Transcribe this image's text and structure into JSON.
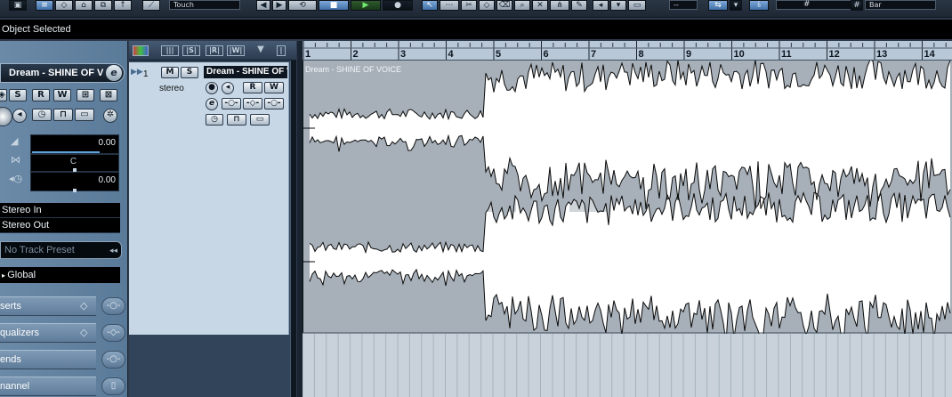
{
  "toolbar": {
    "automation_mode": "Touch",
    "snap_value": "--",
    "quantize": "Bar",
    "grid_icon": "grid-icon"
  },
  "infoline": {
    "text": "Object Selected"
  },
  "inspector": {
    "track_name": "Dream - SHINE OF V",
    "edit_symbol": "e",
    "mute": "M",
    "solo": "S",
    "read": "R",
    "write": "W",
    "volume": "0.00",
    "pan": "C",
    "delay": "0.00",
    "input": "Stereo In",
    "output": "Stereo Out",
    "preset": "No Track Preset",
    "group": "Global",
    "sections": [
      {
        "label": "serts"
      },
      {
        "label": "qualizers"
      },
      {
        "label": "ends"
      },
      {
        "label": "nannel"
      }
    ]
  },
  "tracklist": {
    "number": "1",
    "name": "Dream - SHINE OF VOICE",
    "type": "stereo",
    "mute": "M",
    "solo": "S",
    "read": "R",
    "write": "W",
    "edit_symbol": "e",
    "header_buttons": [
      "|||",
      "|S|",
      "|R|",
      "|W|"
    ]
  },
  "ruler": {
    "bars": [
      "1",
      "2",
      "3",
      "4",
      "5",
      "6",
      "7",
      "8",
      "9",
      "10",
      "11",
      "12",
      "13",
      "14"
    ]
  },
  "event": {
    "name": "Dream - SHINE OF VOICE"
  }
}
